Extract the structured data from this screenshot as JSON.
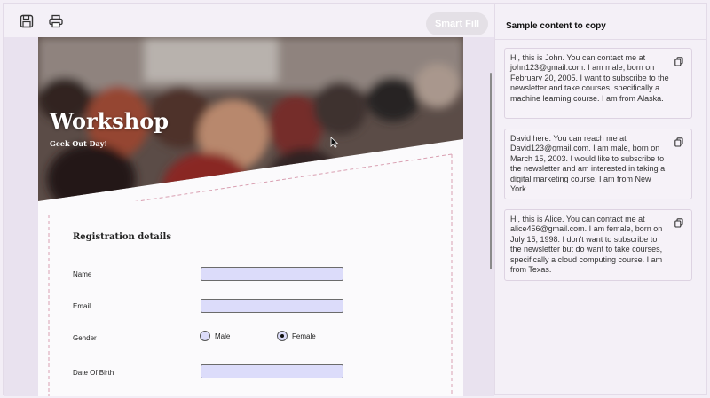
{
  "toolbar": {
    "save_icon": "save-icon",
    "print_icon": "print-icon",
    "smart_fill_label": "Smart Fill"
  },
  "hero": {
    "title": "Workshop",
    "subtitle": "Geek Out Day!"
  },
  "form": {
    "title": "Registration details",
    "fields": {
      "name_label": "Name",
      "email_label": "Email",
      "gender_label": "Gender",
      "dob_label": "Date Of Birth"
    },
    "gender_options": [
      "Male",
      "Female"
    ],
    "gender_selected": "Female"
  },
  "sidebar": {
    "title": "Sample content to copy",
    "samples": [
      "Hi, this is John. You can contact me at john123@gmail.com. I am male, born on February 20, 2005. I want to subscribe to the newsletter and take courses, specifically a machine learning course. I am from Alaska.",
      "David here. You can reach me at David123@gmail.com. I am male, born on March 15, 2003. I would like to subscribe to the newsletter and am interested in taking a digital marketing course. I am from New York.",
      "Hi, this is Alice. You can contact me at alice456@gmail.com. I am female, born on July 15, 1998. I don't want to subscribe to the newsletter but do want to take courses, specifically a cloud computing course. I am from Texas."
    ]
  }
}
